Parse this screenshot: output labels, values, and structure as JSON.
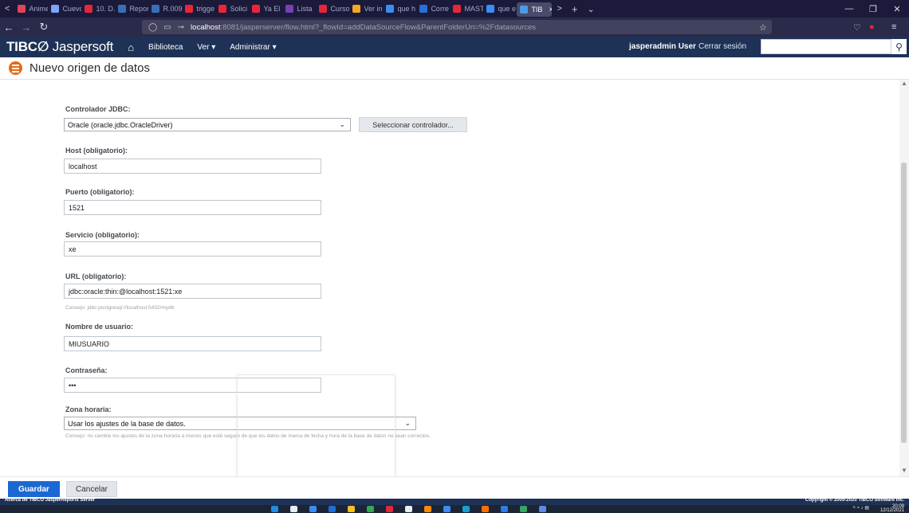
{
  "browser": {
    "tabs": [
      {
        "label": "Anime",
        "color": "#e0445a"
      },
      {
        "label": "Cuevo",
        "color": "#7fa3ff"
      },
      {
        "label": "10. D.",
        "color": "#e8263a"
      },
      {
        "label": "Repor",
        "color": "#3b6fb5"
      },
      {
        "label": "R.009",
        "color": "#3b6fb5"
      },
      {
        "label": "trigge",
        "color": "#e8263a"
      },
      {
        "label": "Solici",
        "color": "#e8263a"
      },
      {
        "label": "Ya El",
        "color": "#e8263a"
      },
      {
        "label": "Lista",
        "color": "#7b3fb2"
      },
      {
        "label": "Curso",
        "color": "#e8263a"
      },
      {
        "label": "Ver in",
        "color": "#f5a623"
      },
      {
        "label": "que h",
        "color": "#3a8df5"
      },
      {
        "label": "Corre",
        "color": "#2a6fd6"
      },
      {
        "label": "MAST",
        "color": "#e8263a"
      },
      {
        "label": "que e",
        "color": "#3a8df5"
      },
      {
        "label": "TIB",
        "color": "#4a9be8",
        "active": true
      }
    ],
    "url_host": "localhost",
    "url_rest": ":8081/jasperserver/flow.html?_flowId=addDataSourceFlow&ParentFolderUri=%2Fdatasources"
  },
  "header": {
    "brand_bold": "TIBC∅",
    "brand_rest": " Jaspersoft",
    "menu": [
      "Biblioteca",
      "Ver ▾",
      "Administrar ▾"
    ],
    "user": "jasperadmin User",
    "logout": "Cerrar sesión",
    "search_placeholder": ""
  },
  "page": {
    "title": "Nuevo origen de datos"
  },
  "form": {
    "driver_label": "Controlador JDBC:",
    "driver_value": "Oracle (oracle.jdbc.OracleDriver)",
    "driver_button": "Seleccionar controlador...",
    "host_label": "Host (obligatorio):",
    "host_value": "localhost",
    "port_label": "Puerto (obligatorio):",
    "port_value": "1521",
    "service_label": "Servicio (obligatorio):",
    "service_value": "xe",
    "url_label": "URL (obligatorio):",
    "url_value": "jdbc:oracle:thin:@localhost:1521:xe",
    "url_hint": "Consejo: jdbc:postgresql://localhost:5432/mydb",
    "user_label": "Nombre de usuario:",
    "user_value": "MIUSUARIO",
    "password_label": "Contraseña:",
    "password_value": "•••",
    "tz_label": "Zona horaria:",
    "tz_value": "Usar los ajustes de la base de datos.",
    "tz_hint": "Consejo: no cambie los ajustes de la zona horaria a menos que esté seguro de que los datos de marca de fecha y hora de la base de datos no sean correctos."
  },
  "buttons": {
    "save": "Guardar",
    "cancel": "Cancelar"
  },
  "footer": {
    "left": "Acerca de TIBCO JasperReports Server",
    "right": "Copyright © 2005-2020 TIBCO Software Inc."
  },
  "taskbar": {
    "time": "20:09",
    "date": "12/12/2021",
    "icons": [
      "#1f8ce6",
      "#e9edf2",
      "#3a8df5",
      "#1f6dd6",
      "#f5c21b",
      "#34a853",
      "#e8263a",
      "#e9edf2",
      "#ff8a00",
      "#3a8df5",
      "#14a1c9",
      "#ff6f00",
      "#2f7ce6",
      "#3ba55d",
      "#5b8be8"
    ]
  }
}
